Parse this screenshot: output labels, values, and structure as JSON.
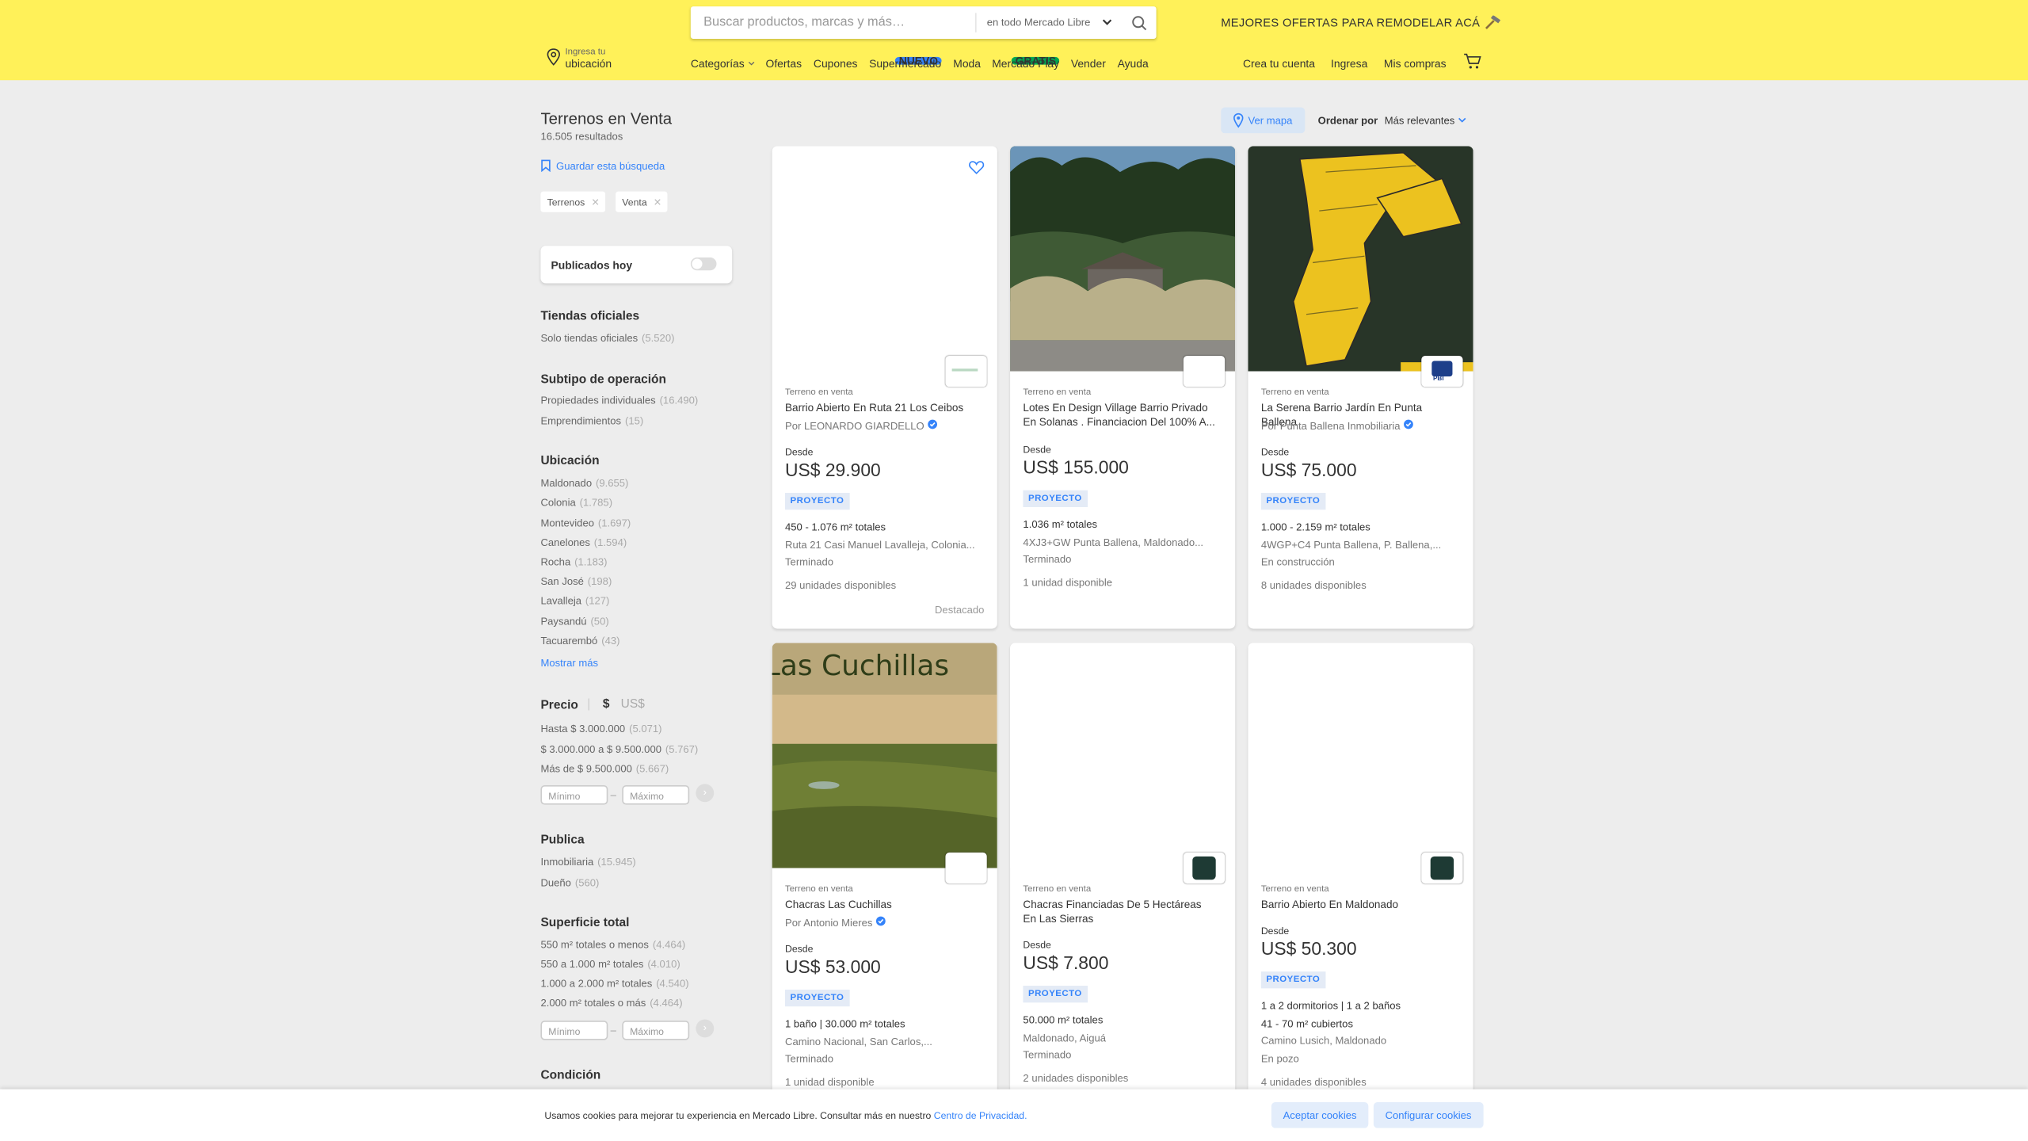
{
  "header": {
    "search": {
      "placeholder": "Buscar productos, marcas y más…",
      "scope": "en todo Mercado Libre"
    },
    "promo": "MEJORES OFERTAS PARA REMODELAR ACÁ",
    "location": {
      "line1": "Ingresa tu",
      "line2": "ubicación"
    },
    "nav": {
      "categorias": "Categorías",
      "ofertas": "Ofertas",
      "cupones": "Cupones",
      "supermercado": "Supermercado",
      "supermercado_badge": "NUEVO",
      "moda": "Moda",
      "mercado_play": "Mercado Play",
      "mercado_play_badge": "GRATIS",
      "vender": "Vender",
      "ayuda": "Ayuda"
    },
    "account": {
      "crea": "Crea tu cuenta",
      "ingresa": "Ingresa",
      "compras": "Mis compras"
    },
    "colors": {
      "brand_yellow": "#fff159",
      "accent_blue": "#3483fa"
    }
  },
  "results": {
    "title": "Terrenos en Venta",
    "count": "16.505 resultados",
    "save_search": "Guardar esta búsqueda",
    "chips": [
      "Terrenos",
      "Venta"
    ],
    "map_button": "Ver mapa",
    "order_label": "Ordenar por",
    "order_value": "Más relevantes"
  },
  "filters": {
    "published_today": "Publicados hoy",
    "tiendas": {
      "title": "Tiendas oficiales",
      "items": [
        {
          "label": "Solo tiendas oficiales",
          "count": "(5.520)"
        }
      ]
    },
    "subtipo": {
      "title": "Subtipo de operación",
      "items": [
        {
          "label": "Propiedades individuales",
          "count": "(16.490)"
        },
        {
          "label": "Emprendimientos",
          "count": "(15)"
        }
      ]
    },
    "ubicacion": {
      "title": "Ubicación",
      "items": [
        {
          "label": "Maldonado",
          "count": "(9.655)"
        },
        {
          "label": "Colonia",
          "count": "(1.785)"
        },
        {
          "label": "Montevideo",
          "count": "(1.697)"
        },
        {
          "label": "Canelones",
          "count": "(1.594)"
        },
        {
          "label": "Rocha",
          "count": "(1.183)"
        },
        {
          "label": "San José",
          "count": "(198)"
        },
        {
          "label": "Lavalleja",
          "count": "(127)"
        },
        {
          "label": "Paysandú",
          "count": "(50)"
        },
        {
          "label": "Tacuarembó",
          "count": "(43)"
        }
      ],
      "more": "Mostrar más"
    },
    "precio": {
      "title": "Precio",
      "cur1": "$",
      "cur2": "US$",
      "items": [
        {
          "label": "Hasta $ 3.000.000",
          "count": "(5.071)"
        },
        {
          "label": "$ 3.000.000 a $ 9.500.000",
          "count": "(5.767)"
        },
        {
          "label": "Más de $ 9.500.000",
          "count": "(5.667)"
        }
      ],
      "min": "Mínimo",
      "max": "Máximo"
    },
    "publica": {
      "title": "Publica",
      "items": [
        {
          "label": "Inmobiliaria",
          "count": "(15.945)"
        },
        {
          "label": "Dueño",
          "count": "(560)"
        }
      ]
    },
    "superficie": {
      "title": "Superficie total",
      "items": [
        {
          "label": "550 m² totales o menos",
          "count": "(4.464)"
        },
        {
          "label": "550 a 1.000 m² totales",
          "count": "(4.010)"
        },
        {
          "label": "1.000 a 2.000 m² totales",
          "count": "(4.540)"
        },
        {
          "label": "2.000 m² totales o más",
          "count": "(4.464)"
        }
      ],
      "min": "Mínimo",
      "max": "Máximo"
    },
    "condicion": {
      "title": "Condición"
    }
  },
  "cards": [
    {
      "kind": "Terreno en venta",
      "title": "Barrio Abierto En Ruta 21 Los Ceibos",
      "by": "Por LEONARDO GIARDELLO",
      "from": "Desde",
      "price": "US$ 29.900",
      "tag": "PROYECTO",
      "attr": "450 - 1.076 m² totales",
      "addr": "Ruta 21 Casi Manuel Lavalleja, Colonia...",
      "status": "Terminado",
      "units": "29 unidades disponibles",
      "destacado": "Destacado"
    },
    {
      "kind": "Terreno en venta",
      "title": "Lotes En Design Village Barrio Privado En Solanas . Financiacion Del 100% A...",
      "by": "",
      "from": "Desde",
      "price": "US$ 155.000",
      "tag": "PROYECTO",
      "attr": "1.036 m² totales",
      "addr": "4XJ3+GW Punta Ballena, Maldonado...",
      "status": "Terminado",
      "units": "1 unidad disponible"
    },
    {
      "kind": "Terreno en venta",
      "title": "La Serena Barrio Jardín En Punta Ballena",
      "by": "Por Punta Ballena Inmobiliaria",
      "from": "Desde",
      "price": "US$ 75.000",
      "tag": "PROYECTO",
      "attr": "1.000 - 2.159 m² totales",
      "addr": "4WGP+C4 Punta Ballena, P. Ballena,...",
      "status": "En construcción",
      "units": "8 unidades disponibles",
      "logo_text": "PBI"
    },
    {
      "kind": "Terreno en venta",
      "title": "Chacras Las Cuchillas",
      "by": "Por Antonio Mieres",
      "from": "Desde",
      "price": "US$ 53.000",
      "tag": "PROYECTO",
      "attr": "1 baño | 30.000 m² totales",
      "addr": "Camino Nacional, San Carlos,...",
      "status": "Terminado",
      "units": "1 unidad disponible",
      "image_text": "Las Cuchillas"
    },
    {
      "kind": "Terreno en venta",
      "title": "Chacras Financiadas De 5 Hectáreas En Las Sierras",
      "by": "",
      "from": "Desde",
      "price": "US$ 7.800",
      "tag": "PROYECTO",
      "attr": "50.000 m² totales",
      "addr": "Maldonado, Aiguá",
      "status": "Terminado",
      "units": "2 unidades disponibles"
    },
    {
      "kind": "Terreno en venta",
      "title": "Barrio Abierto En Maldonado",
      "by": "",
      "from": "Desde",
      "price": "US$ 50.300",
      "tag": "PROYECTO",
      "attr": "1 a 2 dormitorios | 1 a 2 baños",
      "attr2": "41 - 70 m² cubiertos",
      "addr": "Camino Lusich, Maldonado",
      "status": "En pozo",
      "units": "4 unidades disponibles"
    }
  ],
  "cookie": {
    "message": "Usamos cookies para mejorar tu experiencia en Mercado Libre. Consultar más en nuestro",
    "link": "Centro de Privacidad.",
    "accept": "Aceptar cookies",
    "configure": "Configurar cookies"
  }
}
